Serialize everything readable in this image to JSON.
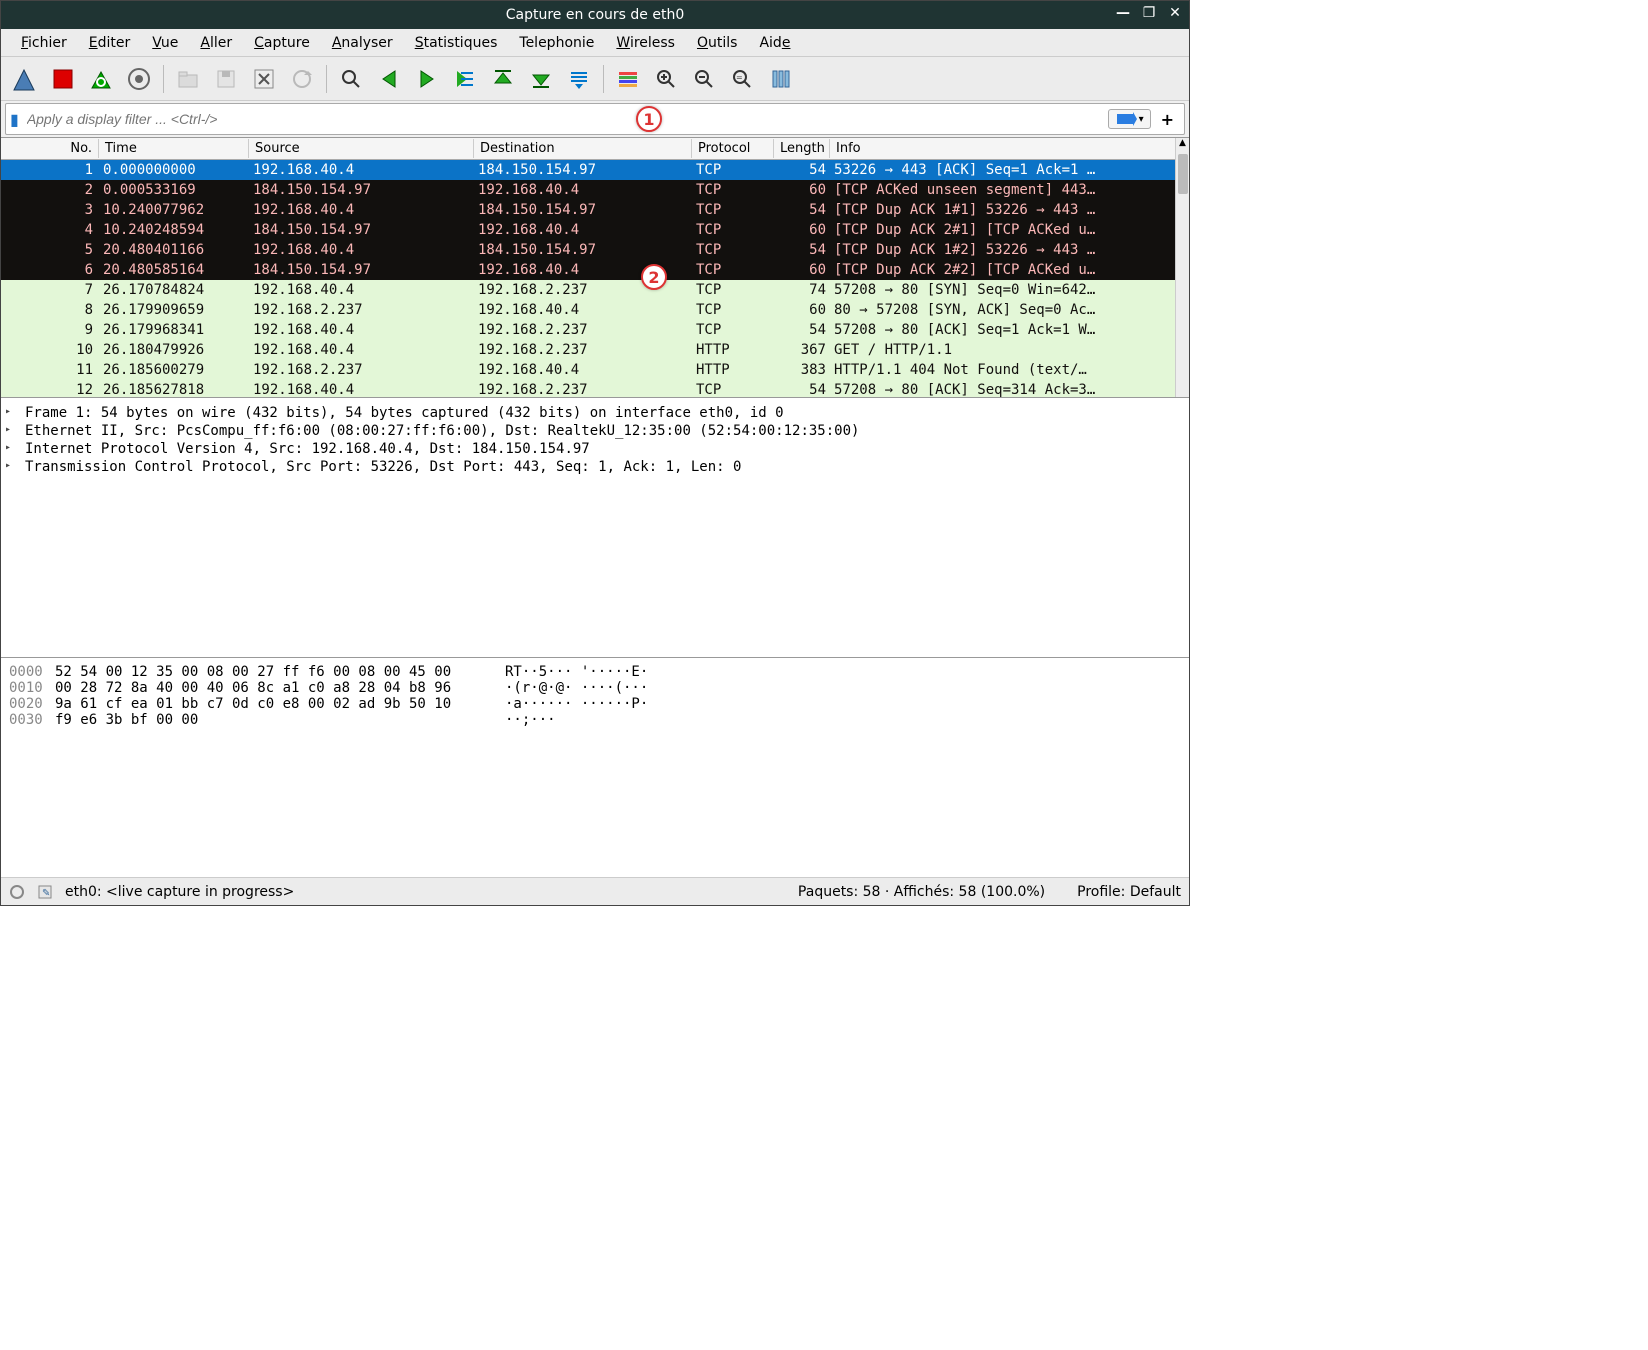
{
  "title": "Capture en cours de eth0",
  "menus": [
    "Fichier",
    "Editer",
    "Vue",
    "Aller",
    "Capture",
    "Analyser",
    "Statistiques",
    "Telephonie",
    "Wireless",
    "Outils",
    "Aide"
  ],
  "filter_placeholder": "Apply a display filter ... <Ctrl-/>",
  "columns": {
    "no": "No.",
    "time": "Time",
    "src": "Source",
    "dst": "Destination",
    "proto": "Protocol",
    "len": "Length",
    "info": "Info"
  },
  "packets": [
    {
      "no": 1,
      "time": "0.000000000",
      "src": "192.168.40.4",
      "dst": "184.150.154.97",
      "proto": "TCP",
      "len": 54,
      "info": "53226 → 443 [ACK] Seq=1 Ack=1 …",
      "cls": "row-sel"
    },
    {
      "no": 2,
      "time": "0.000533169",
      "src": "184.150.154.97",
      "dst": "192.168.40.4",
      "proto": "TCP",
      "len": 60,
      "info": "[TCP ACKed unseen segment] 443…",
      "cls": "row-dark"
    },
    {
      "no": 3,
      "time": "10.240077962",
      "src": "192.168.40.4",
      "dst": "184.150.154.97",
      "proto": "TCP",
      "len": 54,
      "info": "[TCP Dup ACK 1#1] 53226 → 443 …",
      "cls": "row-dark"
    },
    {
      "no": 4,
      "time": "10.240248594",
      "src": "184.150.154.97",
      "dst": "192.168.40.4",
      "proto": "TCP",
      "len": 60,
      "info": "[TCP Dup ACK 2#1] [TCP ACKed u…",
      "cls": "row-dark"
    },
    {
      "no": 5,
      "time": "20.480401166",
      "src": "192.168.40.4",
      "dst": "184.150.154.97",
      "proto": "TCP",
      "len": 54,
      "info": "[TCP Dup ACK 1#2] 53226 → 443 …",
      "cls": "row-dark"
    },
    {
      "no": 6,
      "time": "20.480585164",
      "src": "184.150.154.97",
      "dst": "192.168.40.4",
      "proto": "TCP",
      "len": 60,
      "info": "[TCP Dup ACK 2#2] [TCP ACKed u…",
      "cls": "row-dark"
    },
    {
      "no": 7,
      "time": "26.170784824",
      "src": "192.168.40.4",
      "dst": "192.168.2.237",
      "proto": "TCP",
      "len": 74,
      "info": "57208 → 80 [SYN] Seq=0 Win=642…",
      "cls": "row-green"
    },
    {
      "no": 8,
      "time": "26.179909659",
      "src": "192.168.2.237",
      "dst": "192.168.40.4",
      "proto": "TCP",
      "len": 60,
      "info": "80 → 57208 [SYN, ACK] Seq=0 Ac…",
      "cls": "row-green"
    },
    {
      "no": 9,
      "time": "26.179968341",
      "src": "192.168.40.4",
      "dst": "192.168.2.237",
      "proto": "TCP",
      "len": 54,
      "info": "57208 → 80 [ACK] Seq=1 Ack=1 W…",
      "cls": "row-green"
    },
    {
      "no": 10,
      "time": "26.180479926",
      "src": "192.168.40.4",
      "dst": "192.168.2.237",
      "proto": "HTTP",
      "len": 367,
      "info": "GET / HTTP/1.1",
      "cls": "row-green"
    },
    {
      "no": 11,
      "time": "26.185600279",
      "src": "192.168.2.237",
      "dst": "192.168.40.4",
      "proto": "HTTP",
      "len": 383,
      "info": "HTTP/1.1 404 Not Found  (text/…",
      "cls": "row-green"
    },
    {
      "no": 12,
      "time": "26.185627818",
      "src": "192.168.40.4",
      "dst": "192.168.2.237",
      "proto": "TCP",
      "len": 54,
      "info": "57208 → 80 [ACK] Seq=314 Ack=3…",
      "cls": "row-green"
    }
  ],
  "details": [
    "Frame 1: 54 bytes on wire (432 bits), 54 bytes captured (432 bits) on interface eth0, id 0",
    "Ethernet II, Src: PcsCompu_ff:f6:00 (08:00:27:ff:f6:00), Dst: RealtekU_12:35:00 (52:54:00:12:35:00)",
    "Internet Protocol Version 4, Src: 192.168.40.4, Dst: 184.150.154.97",
    "Transmission Control Protocol, Src Port: 53226, Dst Port: 443, Seq: 1, Ack: 1, Len: 0"
  ],
  "hex": [
    {
      "off": "0000",
      "h": "52 54 00 12 35 00 08 00  27 ff f6 00 08 00 45 00",
      "a": "RT··5··· '·····E·"
    },
    {
      "off": "0010",
      "h": "00 28 72 8a 40 00 40 06  8c a1 c0 a8 28 04 b8 96",
      "a": "·(r·@·@· ····(···"
    },
    {
      "off": "0020",
      "h": "9a 61 cf ea 01 bb c7 0d  c0 e8 00 02 ad 9b 50 10",
      "a": "·a······ ······P·"
    },
    {
      "off": "0030",
      "h": "f9 e6 3b bf 00 00",
      "a": "··;···"
    }
  ],
  "status": {
    "iface": "eth0: <live capture in progress>",
    "pkts": "Paquets: 58 · Affichés: 58 (100.0%)",
    "profile": "Profile: Default"
  },
  "callouts": {
    "1": "1",
    "2": "2"
  }
}
